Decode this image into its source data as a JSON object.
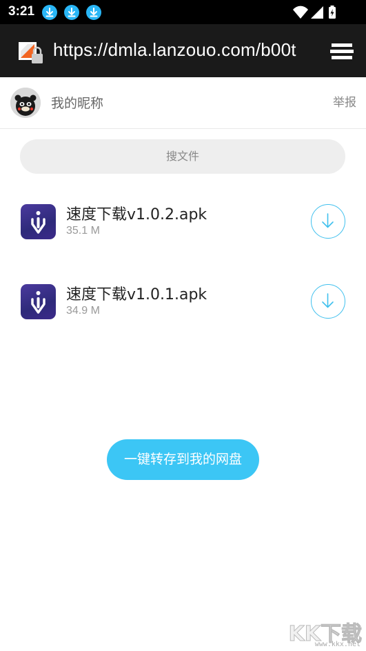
{
  "status_bar": {
    "time": "3:21",
    "notification_icons": [
      "download-icon",
      "download-icon",
      "download-icon"
    ],
    "system_icons": [
      "wifi-icon",
      "signal-icon",
      "battery-charging-icon"
    ]
  },
  "browser": {
    "url": "https://dmla.lanzouo.com/b00t",
    "site_icon": "insecure-lock-icon",
    "menu_icon": "tabs-icon"
  },
  "profile": {
    "nickname": "我的昵称",
    "report_label": "举报"
  },
  "search": {
    "placeholder": "搜文件"
  },
  "files": [
    {
      "name": "速度下载v1.0.2.apk",
      "size": "35.1 M",
      "icon": "app-icon",
      "action_icon": "download-icon"
    },
    {
      "name": "速度下载v1.0.1.apk",
      "size": "34.9 M",
      "icon": "app-icon",
      "action_icon": "download-icon"
    }
  ],
  "actions": {
    "save_to_disk_label": "一键转存到我的网盘"
  },
  "watermark": {
    "logo_text": "KK下载",
    "url": "www.kkx.net"
  },
  "colors": {
    "accent": "#3cc6f5",
    "download_ring": "#3fc0ee",
    "status_bar": "#000000",
    "url_bar": "#1a1a1a",
    "notification": "#29b6f6"
  }
}
